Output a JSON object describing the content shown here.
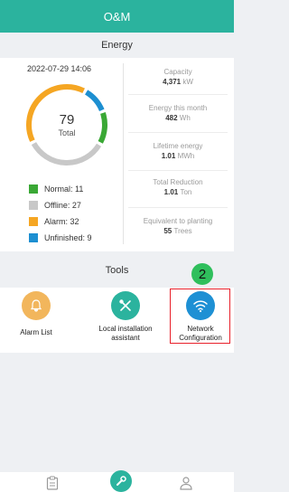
{
  "header": {
    "title": "O&M"
  },
  "energy": {
    "section_title": "Energy",
    "datetime": "2022-07-29 14:06",
    "total_count": "79",
    "total_label": "Total",
    "legend": [
      {
        "label": "Normal: 11",
        "color": "#3aa835",
        "value": 11
      },
      {
        "label": "Offline: 27",
        "color": "#c8c8c8",
        "value": 27
      },
      {
        "label": "Alarm: 32",
        "color": "#f5a623",
        "value": 32
      },
      {
        "label": "Unfinished: 9",
        "color": "#1d8fd1",
        "value": 9
      }
    ],
    "metrics": [
      {
        "label": "Capacity",
        "value": "4,371",
        "unit": "kW"
      },
      {
        "label": "Energy this month",
        "value": "482",
        "unit": "Wh"
      },
      {
        "label": "Lifetime energy",
        "value": "1.01",
        "unit": "MWh"
      },
      {
        "label": "Total Reduction",
        "value": "1.01",
        "unit": "Ton"
      },
      {
        "label": "Equivalent to planting",
        "value": "55",
        "unit": "Trees"
      }
    ]
  },
  "tools": {
    "section_title": "Tools",
    "items": [
      {
        "label": "Alarm List",
        "icon": "bell-icon",
        "color": "#f2b65c"
      },
      {
        "label": "Local installation assistant",
        "icon": "wrench-screwdriver-icon",
        "color": "#2bb39e"
      },
      {
        "label": "Network Configuration",
        "icon": "wifi-icon",
        "color": "#1e90d4"
      }
    ]
  },
  "annotation": {
    "step_number": "2",
    "badge_color": "#2fbf5c",
    "highlight_color": "#e8202a"
  },
  "nav": [
    {
      "icon": "clipboard-icon"
    },
    {
      "icon": "wrench-icon"
    },
    {
      "icon": "user-icon"
    }
  ]
}
